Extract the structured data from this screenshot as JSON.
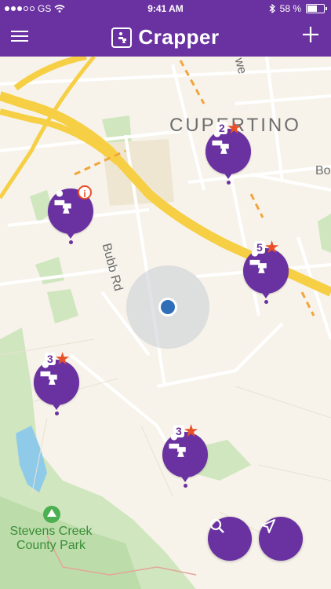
{
  "status_bar": {
    "carrier": "GS",
    "time": "9:41 AM",
    "battery_percent": "58 %",
    "battery_level": 0.58
  },
  "nav": {
    "title": "Crapper",
    "menu_icon": "hamburger-icon",
    "add_icon": "plus-icon",
    "logo_icon": "toilet-logo-icon"
  },
  "map": {
    "labels": {
      "city": "Cupertino",
      "street": "Bubb Rd",
      "street_partial_1": "we",
      "street_partial_2": "Bo",
      "park": "Stevens Creek County Park"
    },
    "pins": [
      {
        "rating": "2",
        "has_star": true,
        "info": false
      },
      {
        "rating": "",
        "has_star": false,
        "info": true,
        "info_symbol": "i"
      },
      {
        "rating": "5",
        "has_star": true,
        "info": false
      },
      {
        "rating": "3",
        "has_star": true,
        "info": false
      },
      {
        "rating": "3",
        "has_star": true,
        "info": false
      }
    ],
    "user_location": "blue-dot"
  },
  "fab": {
    "search_icon": "search-icon",
    "locate_icon": "navigation-arrow-icon"
  },
  "colors": {
    "brand": "#6a32a0",
    "star": "#e8502a",
    "location_dot": "#2e6fb8",
    "major_road": "#f6cf45"
  }
}
